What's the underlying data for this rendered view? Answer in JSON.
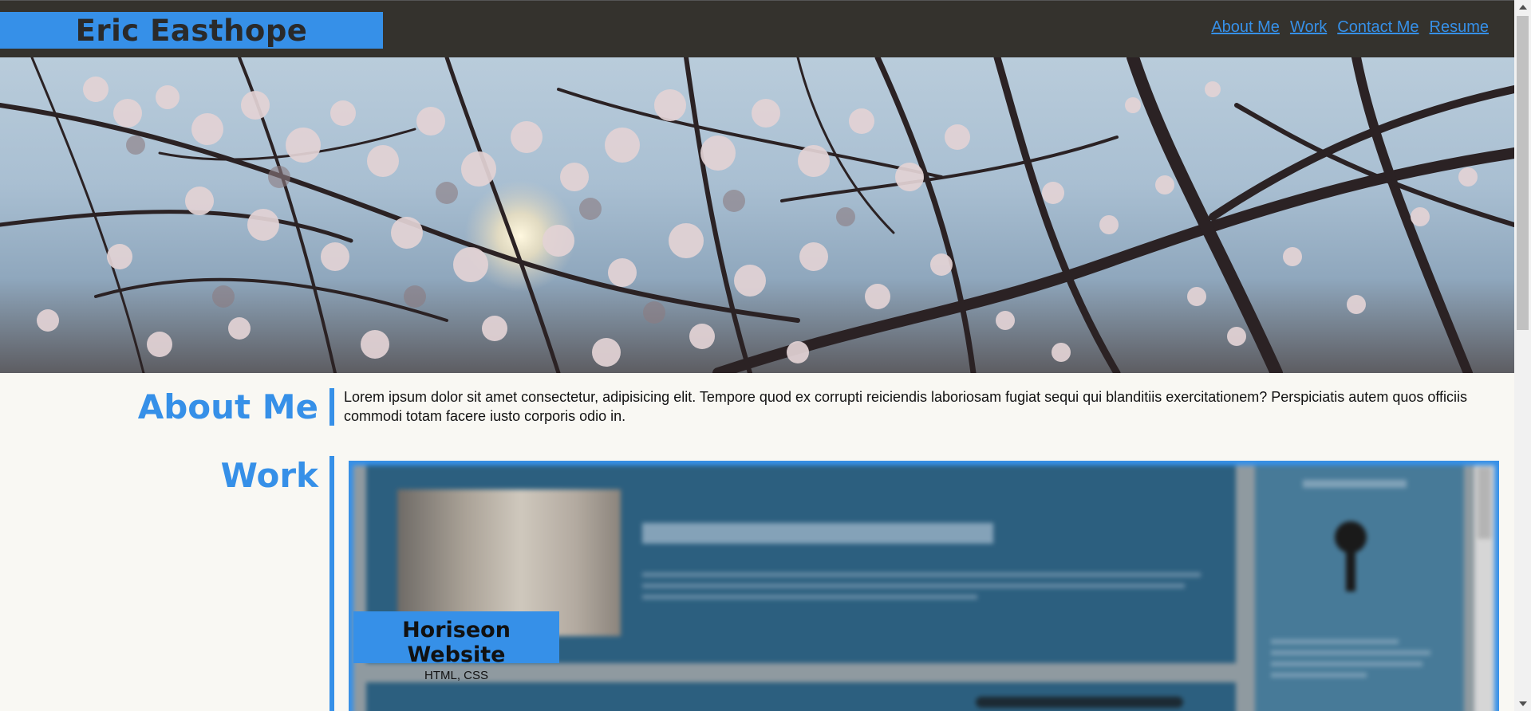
{
  "header": {
    "brand": "Eric Easthope",
    "nav": [
      "About Me",
      "Work",
      "Contact Me",
      "Resume"
    ]
  },
  "about": {
    "title": "About Me",
    "text": "Lorem ipsum dolor sit amet consectetur, adipisicing elit. Tempore quod ex corrupti reiciendis laboriosam fugiat sequi qui blanditiis exercitationem? Perspiciatis autem quos officiis commodi totam facere iusto corporis odio in."
  },
  "work": {
    "title": "Work",
    "projects": [
      {
        "name": "Horiseon Website",
        "tech": "HTML, CSS"
      }
    ]
  },
  "colors": {
    "accent": "#3690e8",
    "header_bg": "#34322d",
    "page_bg": "#f9f8f3"
  }
}
